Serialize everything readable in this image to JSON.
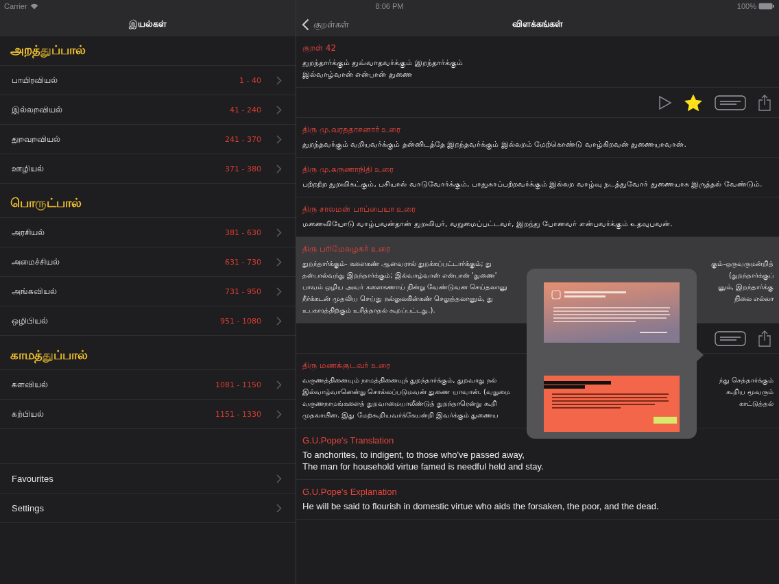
{
  "status_bar": {
    "carrier": "Carrier",
    "time": "8:06 PM",
    "battery": "100%"
  },
  "sidebar": {
    "title": "இயல்கள்",
    "groups": [
      {
        "heading": "அறத்துப்பால்",
        "items": [
          {
            "label": "பாயிரவியல்",
            "range": "1 - 40"
          },
          {
            "label": "இல்லறவியல்",
            "range": "41 - 240"
          },
          {
            "label": "துறவறவியல்",
            "range": "241 - 370"
          },
          {
            "label": "ஊழியல்",
            "range": "371 - 380"
          }
        ]
      },
      {
        "heading": "பொருட்பால்",
        "items": [
          {
            "label": "அரசியல்",
            "range": "381 - 630"
          },
          {
            "label": "அமைச்சியல்",
            "range": "631 - 730"
          },
          {
            "label": "அங்கவியல்",
            "range": "731 - 950"
          },
          {
            "label": "ஒழிபியல்",
            "range": "951 - 1080"
          }
        ]
      },
      {
        "heading": "காமத்துப்பால்",
        "items": [
          {
            "label": "களவியல்",
            "range": "1081 - 1150"
          },
          {
            "label": "கற்பியல்",
            "range": "1151 - 1330"
          }
        ]
      }
    ],
    "links": [
      {
        "label": "Favourites"
      },
      {
        "label": "Settings"
      }
    ]
  },
  "detail": {
    "back_label": "குறள்கள்",
    "title": "விளக்கங்கள்",
    "sections": [
      {
        "kind": "text",
        "heading": "குறள் 42",
        "selected": false,
        "lines": [
          "துறந்தார்க்கும் துவ்வாதவர்க்கும் இறந்தார்க்கும்",
          "இல்வாழ்வான் என்பான் துணை"
        ]
      },
      {
        "kind": "actions",
        "buttons": [
          {
            "kind": "play"
          },
          {
            "kind": "favourite",
            "on": true
          },
          {
            "kind": "text"
          },
          {
            "kind": "share"
          }
        ]
      },
      {
        "kind": "text",
        "heading": "திரு மு.வரததாசனார் உரை",
        "selected": false,
        "lines": [
          "துறந்தவர்கும் வறியவர்க்கும் தன்னிடத்தே இறந்தவர்க்கும் இல்லறம் மேற்கொண்டு வாழ்கிறவன் துணையாவான்."
        ]
      },
      {
        "kind": "text",
        "heading": "திரு மு.கருணாநிதி உரை",
        "selected": false,
        "lines": [
          "பற்றற்ற துறவிகட்கும், பசியால் வாடுவோர்க்கும், பாதுகாப்பற்றவர்க்கும் இல்லற வாழ்வு நடத்துவோர் துணையாக இருத்தல் வேண்டும்."
        ]
      },
      {
        "kind": "text",
        "heading": "திரு சாலமன் பாப்பையா உரை",
        "selected": false,
        "lines": [
          "மனைவியோடு வாழ்பவன்தான் துறவியர், வறுமைப்பட்டவர், இறந்து போனவர் என்பவர்க்கும் உதவுபவன்."
        ]
      },
      {
        "kind": "split",
        "heading": "திரு பரிமேலழகர் உரை",
        "selected": true,
        "lines": [
          {
            "left": "துறந்தார்க்கும்- களைகண் ஆனவரால் துறக்கப்பட்டார்க்கும்; து",
            "right": "கும்-ஒருவருமன்றித்"
          },
          {
            "left": "தன்பால்வந்து இறந்தார்க்கும்; இல்வாழ்வான் என்பான் 'துணை'",
            "right": "(துறந்தார்க்குப்"
          },
          {
            "left": "பாவம் ஒழிய அவர் களைகணாய் நின்று வேண்டுவன செய்தலானு",
            "right": "னும், இறந்தார்க்கு"
          },
          {
            "left": "நீர்க்கடன் முதலிய செய்து நல்லுலகின்கண் செலுத்தலானும், து",
            "right": "நிலை எல்லா"
          },
          {
            "left": "உபகாரத்திற்கும் உரித்தாதல் கூறப்பட்டது.)."
          }
        ]
      },
      {
        "kind": "actions",
        "buttons": [
          {
            "kind": "text"
          },
          {
            "kind": "share"
          }
        ]
      },
      {
        "kind": "split",
        "heading": "திரு மணக்குடவர் உரை",
        "selected": false,
        "lines": [
          {
            "left": "வருணத்தினையும் நாமத்தினையுந் துறந்தார்க்கும், துறவாது நல்",
            "right": "ந்து செத்தார்க்கும்"
          },
          {
            "left": "இல்வாழ்வானென்று சொல்லப்படுமவன் துணை யாவான். (வறுமை",
            "right": "கூறிய மூவரும்"
          },
          {
            "left": "வருணநாமங்களைத் துறவாமையாலீண்டுத் துறந்தாரென்று கூறி",
            "right": "காட்டுத்தல்"
          },
          {
            "left": "முதலாயின. இது மேற்கூறியவர்க்கேயன்றி இவர்க்கும் துணைய"
          }
        ]
      },
      {
        "kind": "text",
        "heading": "G.U.Pope's Translation",
        "selected": false,
        "lines": [
          "To anchorites, to indigent, to those who've passed away,",
          "The man for household virtue famed is needful held and stay."
        ]
      },
      {
        "kind": "text",
        "heading": "G.U.Pope's Explanation",
        "selected": false,
        "lines": [
          "He will be said to flourish in domestic virtue who aids the forsaken, the poor, and the dead."
        ]
      }
    ]
  }
}
